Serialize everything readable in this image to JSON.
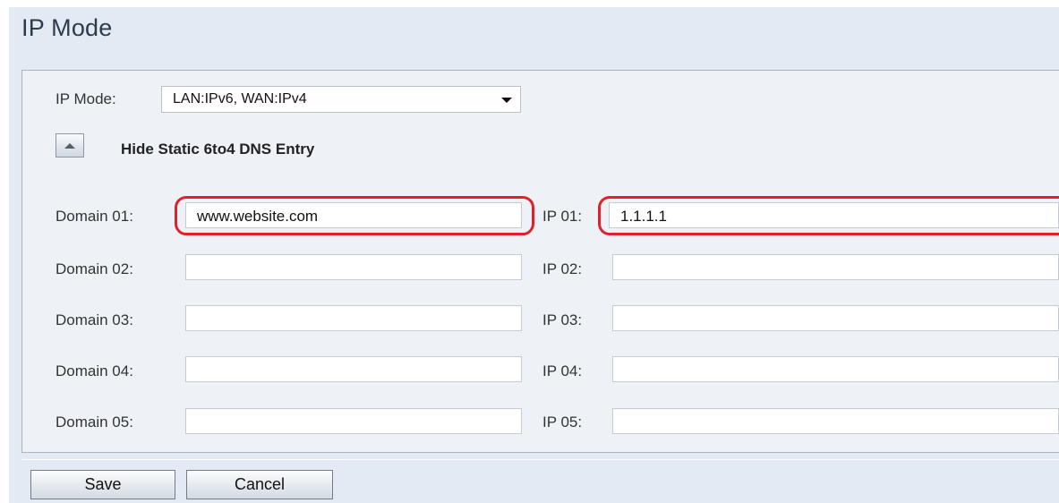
{
  "page": {
    "title": "IP Mode"
  },
  "ip_mode": {
    "label": "IP Mode:",
    "selected": "LAN:IPv6, WAN:IPv4"
  },
  "dns_section": {
    "toggle_label": "Hide Static 6to4 DNS Entry"
  },
  "entries": [
    {
      "domain_label": "Domain 01:",
      "domain_value": "www.website.com",
      "ip_label": "IP 01:",
      "ip_value": "1.1.1.1"
    },
    {
      "domain_label": "Domain 02:",
      "domain_value": "",
      "ip_label": "IP 02:",
      "ip_value": ""
    },
    {
      "domain_label": "Domain 03:",
      "domain_value": "",
      "ip_label": "IP 03:",
      "ip_value": ""
    },
    {
      "domain_label": "Domain 04:",
      "domain_value": "",
      "ip_label": "IP 04:",
      "ip_value": ""
    },
    {
      "domain_label": "Domain 05:",
      "domain_value": "",
      "ip_label": "IP 05:",
      "ip_value": ""
    }
  ],
  "buttons": {
    "save": "Save",
    "cancel": "Cancel"
  },
  "colors": {
    "highlight": "#e0212b",
    "page_bg": "#e4eaf3",
    "panel_bg": "#eef2f7"
  },
  "icons": {
    "dropdown": "chevron-down-icon",
    "toggle": "triangle-up-icon"
  }
}
